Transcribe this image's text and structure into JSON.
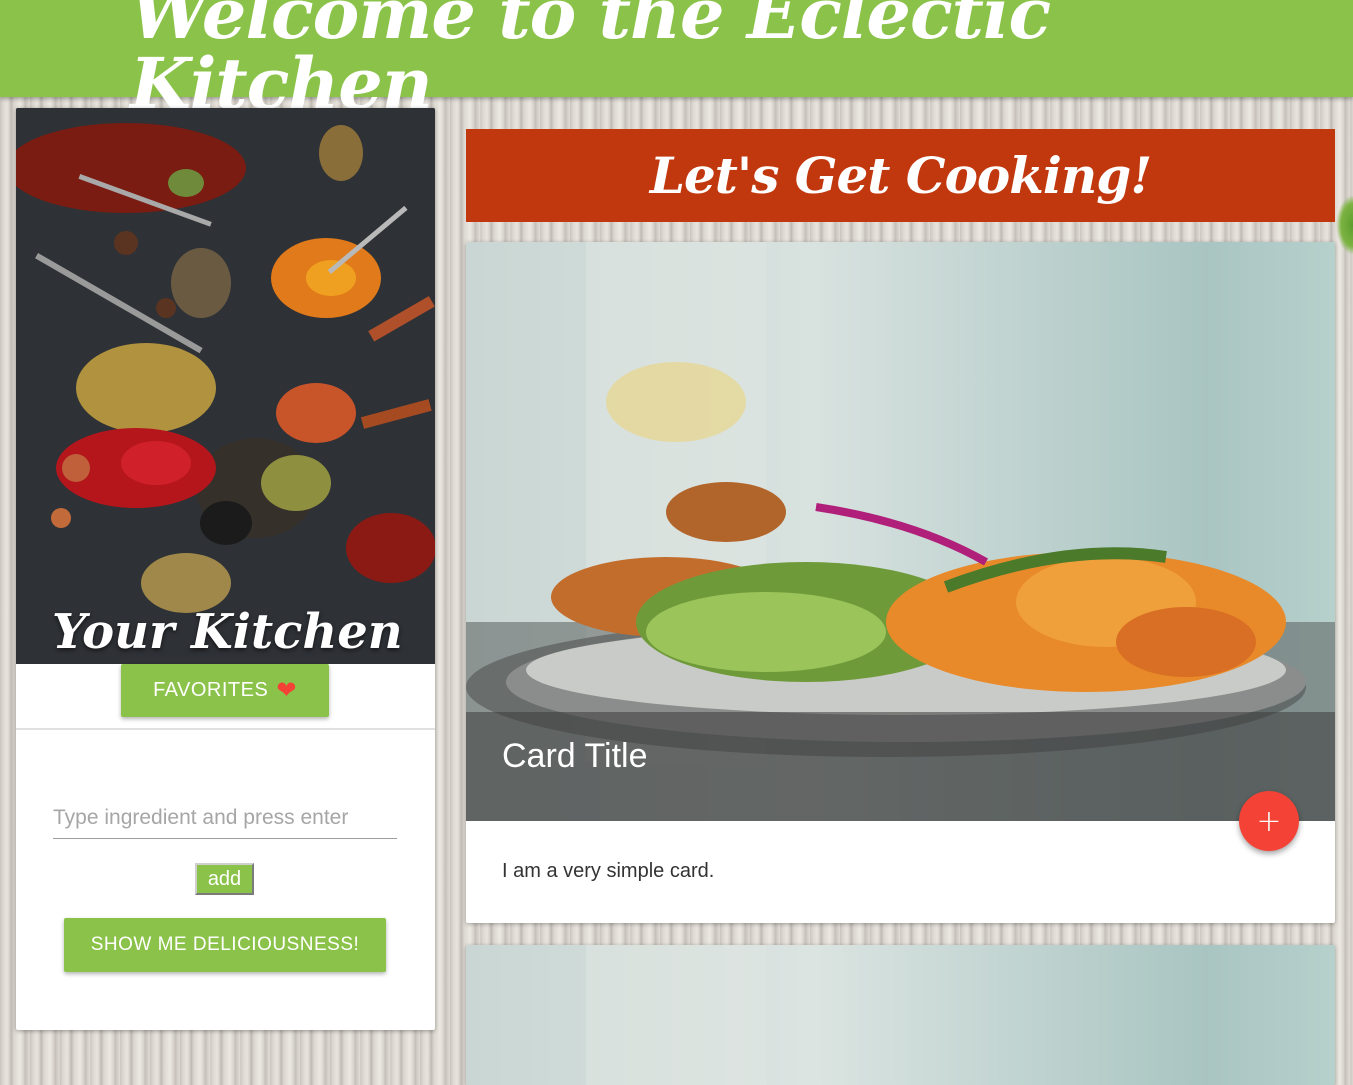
{
  "header": {
    "title": "Welcome to the Eclectic Kitchen"
  },
  "sidebar": {
    "image_alt": "spices-photo",
    "title": "Your Kitchen",
    "favorites_label": "FAVORITES",
    "ingredient_placeholder": "Type ingredient and press enter",
    "add_label": "add",
    "show_label": "SHOW ME DELICIOUSNESS!"
  },
  "main": {
    "banner_title": "Let's Get Cooking!",
    "cards": [
      {
        "title": "Card Title",
        "text": "I am a very simple card.",
        "fab_label": "+"
      }
    ]
  },
  "colors": {
    "green": "#8bc34a",
    "banner_red": "#c2380e",
    "fab_red": "#f44336"
  },
  "icons": [
    "heart-icon",
    "plus-icon"
  ]
}
